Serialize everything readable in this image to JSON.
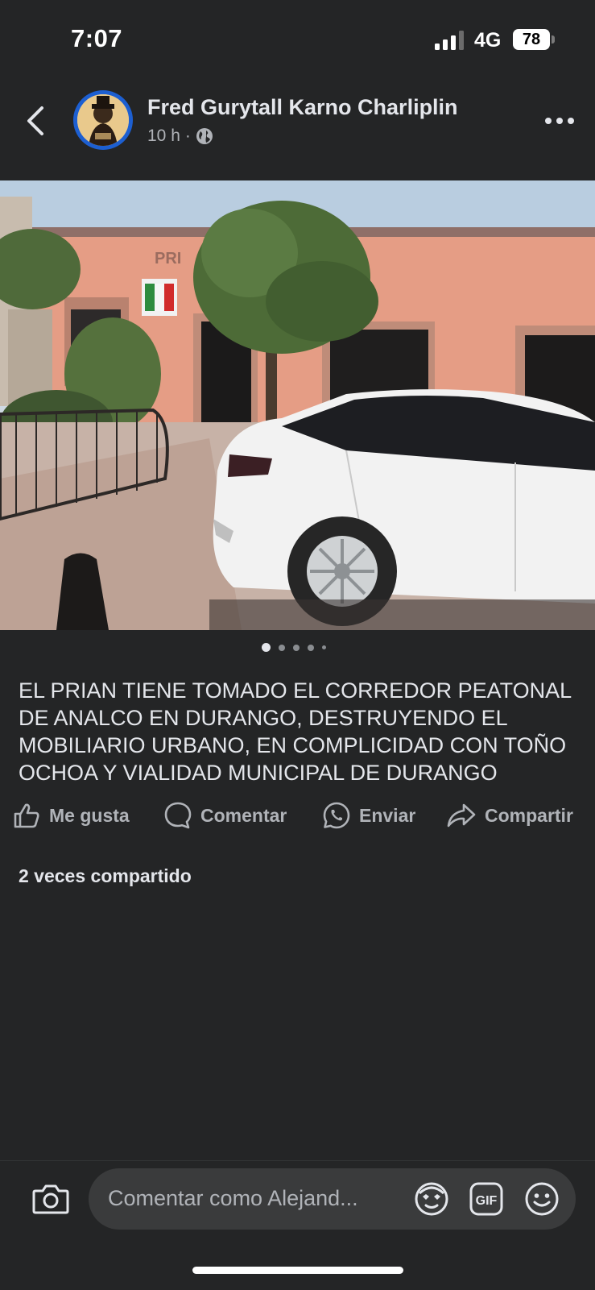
{
  "status_bar": {
    "time": "7:07",
    "network": "4G",
    "battery": "78"
  },
  "post": {
    "author": "Fred Gurytall Karno Charliplin",
    "time_ago": "10 h",
    "audience_icon": "globe-icon",
    "photo_description_icon": "photo",
    "photo_count": 5,
    "active_photo": 1,
    "caption": "EL PRIAN TIENE TOMADO EL CORREDOR PEATONAL DE ANALCO EN DURANGO, DESTRUYENDO EL MOBILIARIO URBANO, EN COMPLICIDAD CON TOÑO OCHOA Y VIALIDAD MUNICIPAL DE DURANGO",
    "actions": {
      "like": "Me gusta",
      "comment": "Comentar",
      "send": "Enviar",
      "share": "Compartir"
    },
    "shares_text": "2 veces compartido"
  },
  "composer": {
    "placeholder": "Comentar como Alejand..."
  },
  "photo_sign": {
    "party": "PRI",
    "logo_letters": "PRI"
  },
  "colors": {
    "background": "#242526",
    "text": "#e4e6eb",
    "secondary": "#b0b3b8",
    "input": "#3a3b3c"
  }
}
